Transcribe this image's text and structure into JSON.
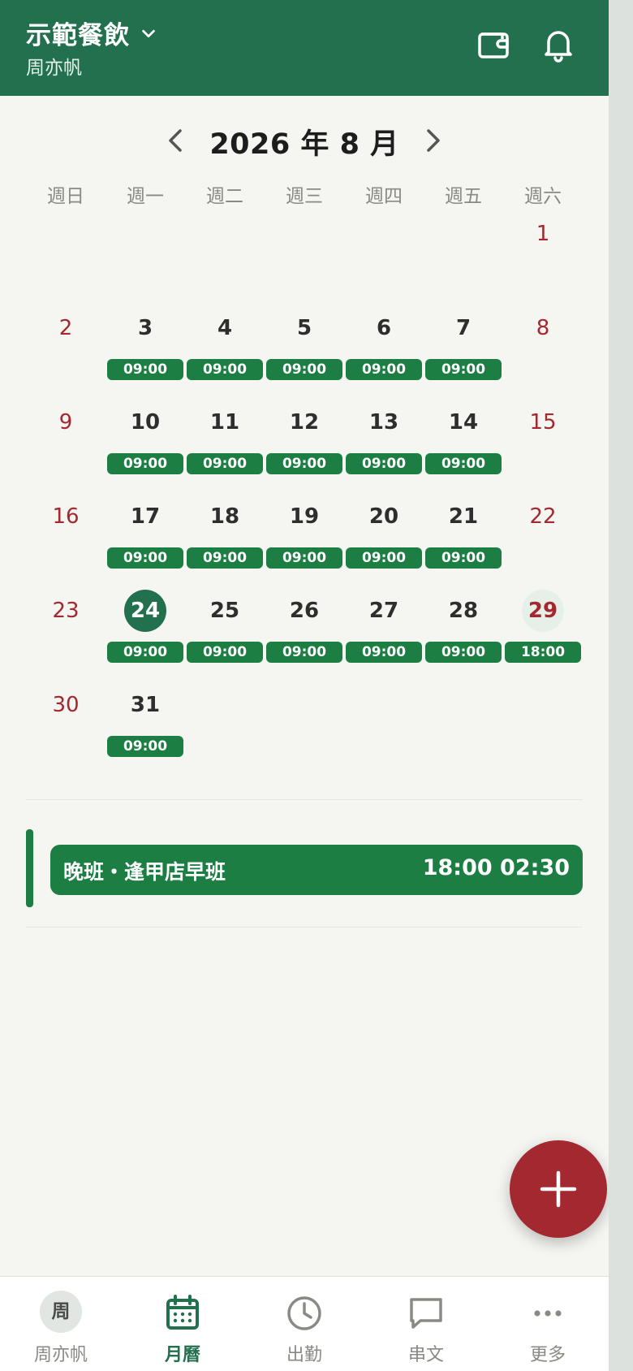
{
  "header": {
    "org_name": "示範餐飲",
    "user_name": "周亦帆"
  },
  "calendar": {
    "month_title": "2026 年 8 月",
    "weekdays": [
      "週日",
      "週一",
      "週二",
      "週三",
      "週四",
      "週五",
      "週六"
    ],
    "weeks": [
      [
        {
          "d": ""
        },
        {
          "d": ""
        },
        {
          "d": ""
        },
        {
          "d": ""
        },
        {
          "d": ""
        },
        {
          "d": ""
        },
        {
          "d": "1",
          "we": true
        }
      ],
      [
        {
          "d": "2",
          "we": true
        },
        {
          "d": "3",
          "s": "09:00"
        },
        {
          "d": "4",
          "s": "09:00"
        },
        {
          "d": "5",
          "s": "09:00"
        },
        {
          "d": "6",
          "s": "09:00"
        },
        {
          "d": "7",
          "s": "09:00"
        },
        {
          "d": "8",
          "we": true
        }
      ],
      [
        {
          "d": "9",
          "we": true
        },
        {
          "d": "10",
          "s": "09:00"
        },
        {
          "d": "11",
          "s": "09:00"
        },
        {
          "d": "12",
          "s": "09:00"
        },
        {
          "d": "13",
          "s": "09:00"
        },
        {
          "d": "14",
          "s": "09:00"
        },
        {
          "d": "15",
          "we": true
        }
      ],
      [
        {
          "d": "16",
          "we": true
        },
        {
          "d": "17",
          "s": "09:00"
        },
        {
          "d": "18",
          "s": "09:00"
        },
        {
          "d": "19",
          "s": "09:00"
        },
        {
          "d": "20",
          "s": "09:00"
        },
        {
          "d": "21",
          "s": "09:00"
        },
        {
          "d": "22",
          "we": true
        }
      ],
      [
        {
          "d": "23",
          "we": true
        },
        {
          "d": "24",
          "s": "09:00",
          "today": true
        },
        {
          "d": "25",
          "s": "09:00"
        },
        {
          "d": "26",
          "s": "09:00"
        },
        {
          "d": "27",
          "s": "09:00"
        },
        {
          "d": "28",
          "s": "09:00"
        },
        {
          "d": "29",
          "s": "18:00",
          "we": true,
          "selected": true
        }
      ],
      [
        {
          "d": "30",
          "we": true
        },
        {
          "d": "31",
          "s": "09:00"
        },
        {
          "d": ""
        },
        {
          "d": ""
        },
        {
          "d": ""
        },
        {
          "d": ""
        },
        {
          "d": ""
        }
      ]
    ]
  },
  "selected_shift": {
    "name": "晚班・逢甲店早班",
    "time": "18:00 02:30"
  },
  "bottom_nav": [
    {
      "label": "周亦帆",
      "icon": "avatar",
      "avatar_text": "周"
    },
    {
      "label": "月曆",
      "icon": "calendar-icon",
      "active": true
    },
    {
      "label": "出勤",
      "icon": "clock-icon"
    },
    {
      "label": "串文",
      "icon": "chat-icon"
    },
    {
      "label": "更多",
      "icon": "more-icon"
    }
  ],
  "colors": {
    "primary": "#22704e",
    "shift": "#1c7e43",
    "accent_red": "#a3282f",
    "background": "#f5f5f1"
  }
}
